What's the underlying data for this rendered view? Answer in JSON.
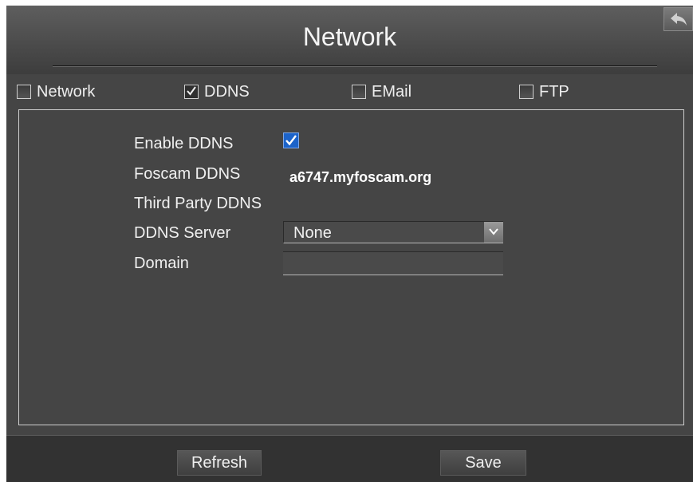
{
  "header": {
    "title": "Network",
    "back_icon": "back-arrow-icon"
  },
  "tabs": [
    {
      "label": "Network",
      "checked": false
    },
    {
      "label": "DDNS",
      "checked": true
    },
    {
      "label": "EMail",
      "checked": false
    },
    {
      "label": "FTP",
      "checked": false
    }
  ],
  "form": {
    "enable_label": "Enable DDNS",
    "enable_checked": true,
    "foscam_label": "Foscam DDNS",
    "foscam_value": "a6747.myfoscam.org",
    "third_party_label": "Third Party DDNS",
    "server_label": "DDNS Server",
    "server_value": "None",
    "domain_label": "Domain",
    "domain_value": ""
  },
  "footer": {
    "refresh_label": "Refresh",
    "save_label": "Save"
  },
  "colors": {
    "background": "#454545",
    "accent_check": "#1c63c9",
    "text": "#f0f0f0"
  }
}
